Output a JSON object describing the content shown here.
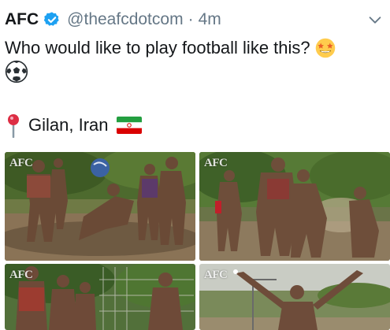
{
  "tweet": {
    "author_name": "AFC",
    "handle": "@theafcdotcom",
    "separator": "·",
    "time": "4m",
    "text_line1": "Who would like to play football like this?",
    "location": "Gilan, Iran"
  },
  "icons": {
    "verified": "verified-badge-icon",
    "caret": "chevron-down-icon",
    "emoji_star_eyes": "star-struck-emoji",
    "emoji_ball": "soccer-ball-emoji",
    "pin": "round-pushpin-icon",
    "flag": "iran-flag-icon"
  },
  "media": {
    "watermarks": [
      "AFC",
      "AFC",
      "AFC",
      "AFC"
    ]
  },
  "colors": {
    "text": "#14171a",
    "secondary": "#657786",
    "verified_blue": "#1da1f2"
  }
}
